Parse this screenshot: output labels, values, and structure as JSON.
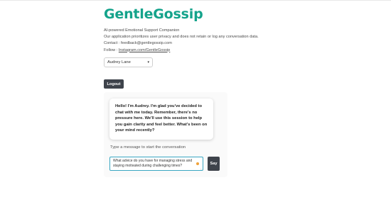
{
  "app": {
    "title": "GentleGossip",
    "tagline": "AI-powered Emotional Support Companion",
    "privacy_note": "Our application prioritizes user privacy and does not retain or log any conversation data.",
    "contact_label": "Contact : ",
    "contact_email": "feedback@gentlegossip.com",
    "follow_label": "Follow : ",
    "follow_link": "Instagram.com/GentleGossip"
  },
  "persona_select": {
    "selected": "Audrey Lane"
  },
  "logout_label": "Logout",
  "chat": {
    "assistant_message": "Hello! I'm Audrey. I'm glad you've decided to chat with me today. Remember, there's no pressure here. We'll use this session to help you gain clarity and feel better. What's been on your mind recently?",
    "prompt_label": "Type a message to start the conversation",
    "input_value": "What advice do you have for managing stress and staying motivated during challenging times?",
    "send_label": "Say"
  },
  "colors": {
    "brand": "#14a38b",
    "button_bg": "#3e434b",
    "input_border": "#3aa7c2"
  }
}
